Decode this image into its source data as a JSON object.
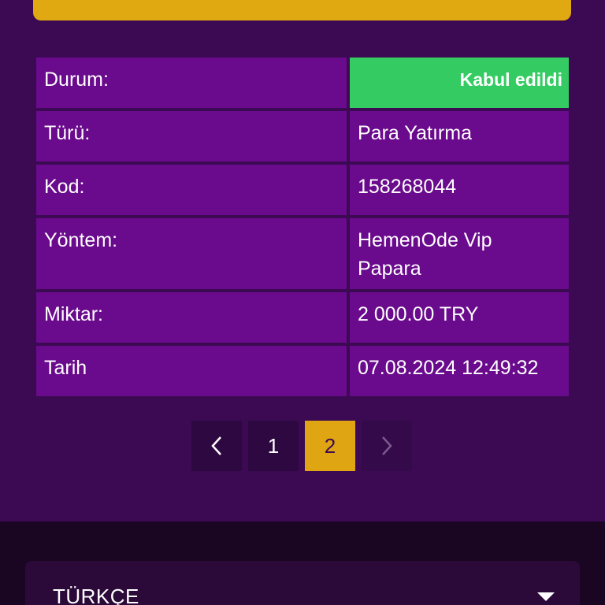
{
  "details": {
    "status": {
      "label": "Durum:",
      "value": "Kabul edildi",
      "color": "#34cc62"
    },
    "type": {
      "label": "Türü:",
      "value": "Para Yatırma"
    },
    "code": {
      "label": "Kod:",
      "value": "158268044"
    },
    "method": {
      "label": "Yöntem:",
      "value": "HemenOde Vip Papara"
    },
    "amount": {
      "label": "Miktar:",
      "value": "2 000.00 TRY"
    },
    "date": {
      "label": "Tarih",
      "value": "07.08.2024 12:49:32"
    }
  },
  "pagination": {
    "prev_icon": "chevron-left-icon",
    "pages": [
      "1",
      "2"
    ],
    "current_page": "2",
    "next_icon": "chevron-right-icon"
  },
  "footer": {
    "language": "TÜRKÇE",
    "dropdown_icon": "caret-down-icon"
  },
  "colors": {
    "accent": "#e0a912",
    "cell_bg": "#6a0a8c",
    "page_bg": "#3b0a52"
  }
}
